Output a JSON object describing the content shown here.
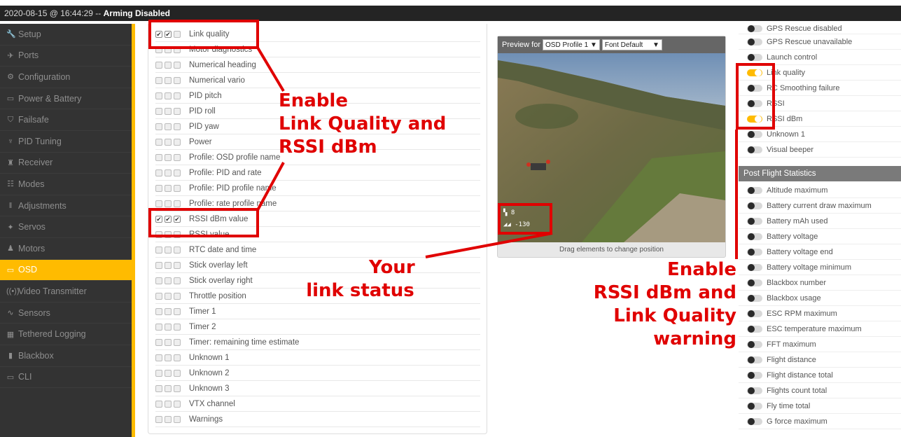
{
  "titlebar": {
    "prefix": "2020-08-15 @ 16:44:29 -- ",
    "status": "Arming Disabled"
  },
  "sidebar": {
    "items": [
      {
        "label": "Setup",
        "icon": "wrench-icon",
        "glyph": "🔧"
      },
      {
        "label": "Ports",
        "icon": "plug-icon",
        "glyph": "✈"
      },
      {
        "label": "Configuration",
        "icon": "gear-icon",
        "glyph": "⚙"
      },
      {
        "label": "Power & Battery",
        "icon": "battery-icon",
        "glyph": "▭"
      },
      {
        "label": "Failsafe",
        "icon": "shield-icon",
        "glyph": "⛉"
      },
      {
        "label": "PID Tuning",
        "icon": "tuning-icon",
        "glyph": "♆"
      },
      {
        "label": "Receiver",
        "icon": "receiver-icon",
        "glyph": "♜"
      },
      {
        "label": "Modes",
        "icon": "modes-icon",
        "glyph": "☷"
      },
      {
        "label": "Adjustments",
        "icon": "sliders-icon",
        "glyph": "‖"
      },
      {
        "label": "Servos",
        "icon": "servo-icon",
        "glyph": "✦"
      },
      {
        "label": "Motors",
        "icon": "motor-icon",
        "glyph": "♟"
      },
      {
        "label": "OSD",
        "icon": "osd-icon",
        "glyph": "▭",
        "active": true
      },
      {
        "label": "Video Transmitter",
        "icon": "antenna-icon",
        "glyph": "((•))"
      },
      {
        "label": "Sensors",
        "icon": "pulse-icon",
        "glyph": "∿"
      },
      {
        "label": "Tethered Logging",
        "icon": "keyboard-icon",
        "glyph": "▦"
      },
      {
        "label": "Blackbox",
        "icon": "blackbox-icon",
        "glyph": "▮"
      },
      {
        "label": "CLI",
        "icon": "terminal-icon",
        "glyph": "▭"
      }
    ]
  },
  "elements": [
    {
      "label": "Link quality",
      "checks": [
        true,
        true,
        false
      ]
    },
    {
      "label": "Motor diagnostics",
      "checks": [
        false,
        false,
        false
      ]
    },
    {
      "label": "Numerical heading",
      "checks": [
        false,
        false,
        false
      ]
    },
    {
      "label": "Numerical vario",
      "checks": [
        false,
        false,
        false
      ]
    },
    {
      "label": "PID pitch",
      "checks": [
        false,
        false,
        false
      ]
    },
    {
      "label": "PID roll",
      "checks": [
        false,
        false,
        false
      ]
    },
    {
      "label": "PID yaw",
      "checks": [
        false,
        false,
        false
      ]
    },
    {
      "label": "Power",
      "checks": [
        false,
        false,
        false
      ]
    },
    {
      "label": "Profile: OSD profile name",
      "checks": [
        false,
        false,
        false
      ]
    },
    {
      "label": "Profile: PID and rate",
      "checks": [
        false,
        false,
        false
      ]
    },
    {
      "label": "Profile: PID profile name",
      "checks": [
        false,
        false,
        false
      ]
    },
    {
      "label": "Profile: rate profile name",
      "checks": [
        false,
        false,
        false
      ]
    },
    {
      "label": "RSSI dBm value",
      "checks": [
        true,
        true,
        true
      ]
    },
    {
      "label": "RSSI value",
      "checks": [
        false,
        false,
        false
      ]
    },
    {
      "label": "RTC date and time",
      "checks": [
        false,
        false,
        false
      ]
    },
    {
      "label": "Stick overlay left",
      "checks": [
        false,
        false,
        false
      ]
    },
    {
      "label": "Stick overlay right",
      "checks": [
        false,
        false,
        false
      ]
    },
    {
      "label": "Throttle position",
      "checks": [
        false,
        false,
        false
      ]
    },
    {
      "label": "Timer 1",
      "checks": [
        false,
        false,
        false
      ]
    },
    {
      "label": "Timer 2",
      "checks": [
        false,
        false,
        false
      ]
    },
    {
      "label": "Timer: remaining time estimate",
      "checks": [
        false,
        false,
        false
      ]
    },
    {
      "label": "Unknown 1",
      "checks": [
        false,
        false,
        false
      ]
    },
    {
      "label": "Unknown 2",
      "checks": [
        false,
        false,
        false
      ]
    },
    {
      "label": "Unknown 3",
      "checks": [
        false,
        false,
        false
      ]
    },
    {
      "label": "VTX channel",
      "checks": [
        false,
        false,
        false
      ]
    },
    {
      "label": "Warnings",
      "checks": [
        false,
        false,
        false
      ]
    }
  ],
  "preview": {
    "label": "Preview for",
    "profile": "OSD Profile 1",
    "font": "Font Default",
    "footer": "Drag elements to change position",
    "osd_lq": "8",
    "osd_rssi": "-130"
  },
  "warnings": [
    {
      "label": "GPS Rescue disabled",
      "on": false
    },
    {
      "label": "GPS Rescue unavailable",
      "on": false
    },
    {
      "label": "Launch control",
      "on": false
    },
    {
      "label": "Link quality",
      "on": true
    },
    {
      "label": "RC Smoothing failure",
      "on": false
    },
    {
      "label": "RSSI",
      "on": false
    },
    {
      "label": "RSSI dBm",
      "on": true
    },
    {
      "label": "Unknown 1",
      "on": false
    },
    {
      "label": "Visual beeper",
      "on": false
    }
  ],
  "post_flight": {
    "title": "Post Flight Statistics",
    "items": [
      "Altitude maximum",
      "Battery current draw maximum",
      "Battery mAh used",
      "Battery voltage",
      "Battery voltage end",
      "Battery voltage minimum",
      "Blackbox number",
      "Blackbox usage",
      "ESC RPM maximum",
      "ESC temperature maximum",
      "FFT maximum",
      "Flight distance",
      "Flight distance total",
      "Flights count total",
      "Fly time total",
      "G force maximum"
    ]
  },
  "annotations": {
    "enable_lq": [
      "Enable",
      "Link Quality and",
      "RSSI dBm"
    ],
    "link_status": [
      "Your",
      "link status"
    ],
    "warning": [
      "Enable",
      "RSSI dBm and",
      "Link Quality",
      "warning"
    ]
  },
  "colors": {
    "accent": "#ffbb00",
    "annotation": "#e00000",
    "sidebar": "#333333"
  }
}
